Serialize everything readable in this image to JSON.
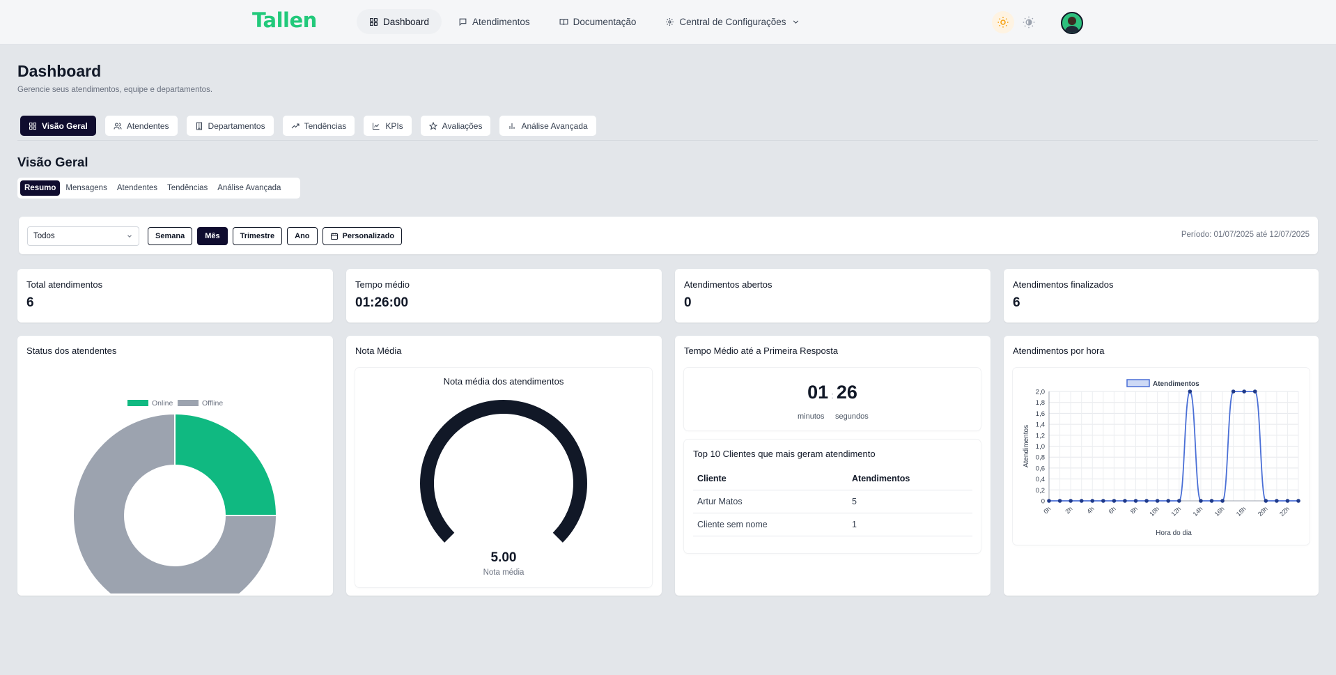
{
  "brand": {
    "logo": "Tallen",
    "accent": "#22c97b",
    "dark": "#0f0c2e"
  },
  "nav": [
    {
      "label": "Dashboard",
      "icon": "grid-icon",
      "active": true
    },
    {
      "label": "Atendimentos",
      "icon": "chat-icon"
    },
    {
      "label": "Documentação",
      "icon": "book-icon"
    },
    {
      "label": "Central de Configurações",
      "icon": "gear-icon"
    }
  ],
  "page": {
    "title": "Dashboard",
    "subtitle": "Gerencie seus atendimentos, equipe e departamentos."
  },
  "tabs": [
    {
      "label": "Visão Geral",
      "icon": "grid-icon",
      "active": true
    },
    {
      "label": "Atendentes",
      "icon": "users-icon"
    },
    {
      "label": "Departamentos",
      "icon": "building-icon"
    },
    {
      "label": "Tendências",
      "icon": "trend-icon"
    },
    {
      "label": "KPIs",
      "icon": "linechart-icon"
    },
    {
      "label": "Avaliações",
      "icon": "star-icon"
    },
    {
      "label": "Análise Avançada",
      "icon": "barchart-icon"
    }
  ],
  "section": {
    "title": "Visão Geral",
    "subtabs": [
      {
        "label": "Resumo",
        "active": true
      },
      {
        "label": "Mensagens"
      },
      {
        "label": "Atendentes"
      },
      {
        "label": "Tendências"
      },
      {
        "label": "Análise Avançada"
      }
    ]
  },
  "filters": {
    "select_value": "Todos",
    "periods": [
      {
        "label": "Semana"
      },
      {
        "label": "Mês",
        "active": true
      },
      {
        "label": "Trimestre"
      },
      {
        "label": "Ano"
      },
      {
        "label": "Personalizado",
        "icon": "calendar-icon"
      }
    ],
    "period_text": "Período: 01/07/2025 até 12/07/2025"
  },
  "stats": [
    {
      "label": "Total atendimentos",
      "value": "6"
    },
    {
      "label": "Tempo médio",
      "value": "01:26:00"
    },
    {
      "label": "Atendimentos abertos",
      "value": "0"
    },
    {
      "label": "Atendimentos finalizados",
      "value": "6"
    }
  ],
  "status_card": {
    "title": "Status dos atendentes"
  },
  "nota_card": {
    "title": "Nota Média",
    "chart_title": "Nota média dos atendimentos",
    "value": "5.00",
    "caption": "Nota média"
  },
  "resposta_card": {
    "title": "Tempo Médio até a Primeira Resposta",
    "minutes": "01",
    "separator": ":",
    "seconds": "26",
    "minutes_label": "minutos",
    "seconds_label": "segundos",
    "top_title": "Top 10 Clientes que mais geram atendimento",
    "columns": [
      "Cliente",
      "Atendimentos"
    ],
    "rows": [
      [
        "Artur Matos",
        "5"
      ],
      [
        "Cliente sem nome",
        "1"
      ]
    ]
  },
  "hora_card": {
    "title": "Atendimentos por hora"
  },
  "chart_data": [
    {
      "type": "pie",
      "categories": [
        "Online",
        "Offline"
      ],
      "values": [
        1,
        3
      ],
      "colors": [
        "#10b981",
        "#9ca3af"
      ],
      "legend": "top"
    },
    {
      "type": "gauge",
      "value": 5.0,
      "max": 5.0,
      "color": "#111827"
    },
    {
      "type": "line",
      "x": [
        "0h",
        "1h",
        "2h",
        "3h",
        "4h",
        "5h",
        "6h",
        "7h",
        "8h",
        "9h",
        "10h",
        "11h",
        "12h",
        "13h",
        "14h",
        "15h",
        "16h",
        "17h",
        "18h",
        "19h",
        "20h",
        "21h",
        "22h",
        "23h"
      ],
      "x_tick_labels": [
        "0h",
        "2h",
        "4h",
        "6h",
        "8h",
        "10h",
        "12h",
        "14h",
        "16h",
        "18h",
        "20h",
        "22h"
      ],
      "series": [
        {
          "name": "Atendimentos",
          "values": [
            0,
            0,
            0,
            0,
            0,
            0,
            0,
            0,
            0,
            0,
            0,
            0,
            0,
            2,
            0,
            0,
            0,
            2,
            2,
            2,
            0,
            0,
            0,
            0
          ]
        }
      ],
      "xlabel": "Hora do dia",
      "ylabel": "Atendimentos",
      "ylim": [
        0,
        2
      ],
      "y_ticks": [
        "0",
        "0,2",
        "0,4",
        "0,6",
        "0,8",
        "1,0",
        "1,2",
        "1,4",
        "1,6",
        "1,8",
        "2,0"
      ],
      "grid": true,
      "legend": "top",
      "color": "#4a6fd6"
    }
  ]
}
